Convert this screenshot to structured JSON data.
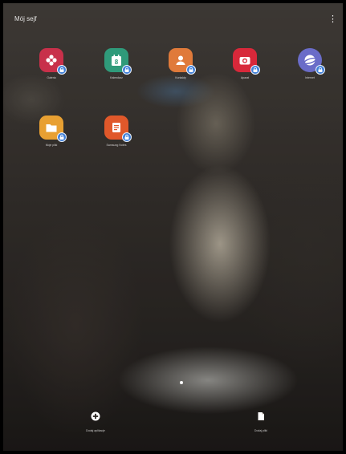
{
  "folder": {
    "title": "Mój sejf",
    "menu_glyph": "⋮"
  },
  "apps": [
    {
      "label": "Galeria",
      "icon": "flower-icon",
      "color": "#c8304a"
    },
    {
      "label": "Kalendarz",
      "icon": "calendar-icon",
      "color": "#2f9a7a"
    },
    {
      "label": "Kontakty",
      "icon": "contact-icon",
      "color": "#e07a3a"
    },
    {
      "label": "Aparat",
      "icon": "camera-icon",
      "color": "#d8283a"
    },
    {
      "label": "Internet",
      "icon": "globe-icon",
      "color": "#6a6cc8"
    },
    {
      "label": "Moje pliki",
      "icon": "folder-icon",
      "color": "#e8a032"
    },
    {
      "label": "Samsung Notes",
      "icon": "note-icon",
      "color": "#e0582a"
    }
  ],
  "badge_color": "#3f7fd8",
  "bottom": {
    "add_apps_label": "Dodaj aplikacje",
    "add_files_label": "Dodaj pliki"
  }
}
